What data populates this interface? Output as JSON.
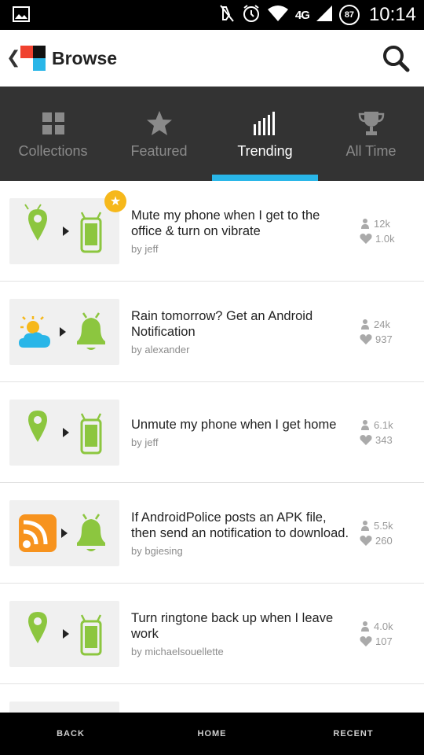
{
  "status_bar": {
    "time": "10:14",
    "network": "4G",
    "battery": "87",
    "icons": [
      "image-icon",
      "mute-icon",
      "alarm-icon",
      "wifi-icon",
      "signal-icon"
    ]
  },
  "action_bar": {
    "title": "Browse",
    "icons": [
      "back-chevron-icon",
      "app-logo-icon",
      "search-icon"
    ]
  },
  "tabs": [
    {
      "label": "Collections",
      "icon": "grid-icon",
      "active": false
    },
    {
      "label": "Featured",
      "icon": "star-icon",
      "active": false
    },
    {
      "label": "Trending",
      "icon": "trending-bars-icon",
      "active": true
    },
    {
      "label": "All Time",
      "icon": "trophy-icon",
      "active": false
    }
  ],
  "recipes": [
    {
      "title": "Mute my phone when I get to the office & turn on vibrate",
      "author": "by jeff",
      "users": "12k",
      "likes": "1.0k",
      "trigger": "location-pin-icon",
      "action": "android-phone-icon",
      "featured": true
    },
    {
      "title": "Rain tomorrow? Get an Android Notification",
      "author": "by alexander",
      "users": "24k",
      "likes": "937",
      "trigger": "weather-icon",
      "action": "notification-bell-icon",
      "featured": false
    },
    {
      "title": "Unmute my phone when I get home",
      "author": "by jeff",
      "users": "6.1k",
      "likes": "343",
      "trigger": "location-pin-icon",
      "action": "android-phone-icon",
      "featured": false
    },
    {
      "title": "If AndroidPolice posts an APK file, then send an notification to download.",
      "author": "by bgiesing",
      "users": "5.5k",
      "likes": "260",
      "trigger": "rss-feed-icon",
      "action": "notification-bell-icon",
      "featured": false
    },
    {
      "title": "Turn ringtone back up when I leave work",
      "author": "by michaelsouellette",
      "users": "4.0k",
      "likes": "107",
      "trigger": "location-pin-icon",
      "action": "android-phone-icon",
      "featured": false
    }
  ],
  "nav_bar": {
    "back": "BACK",
    "home": "HOME",
    "recent": "RECENT"
  },
  "colors": {
    "accent": "#29b6e8",
    "green": "#8cc63f",
    "tab_bg": "#333333",
    "badge": "#f6b81b",
    "rss": "#f7931e"
  }
}
